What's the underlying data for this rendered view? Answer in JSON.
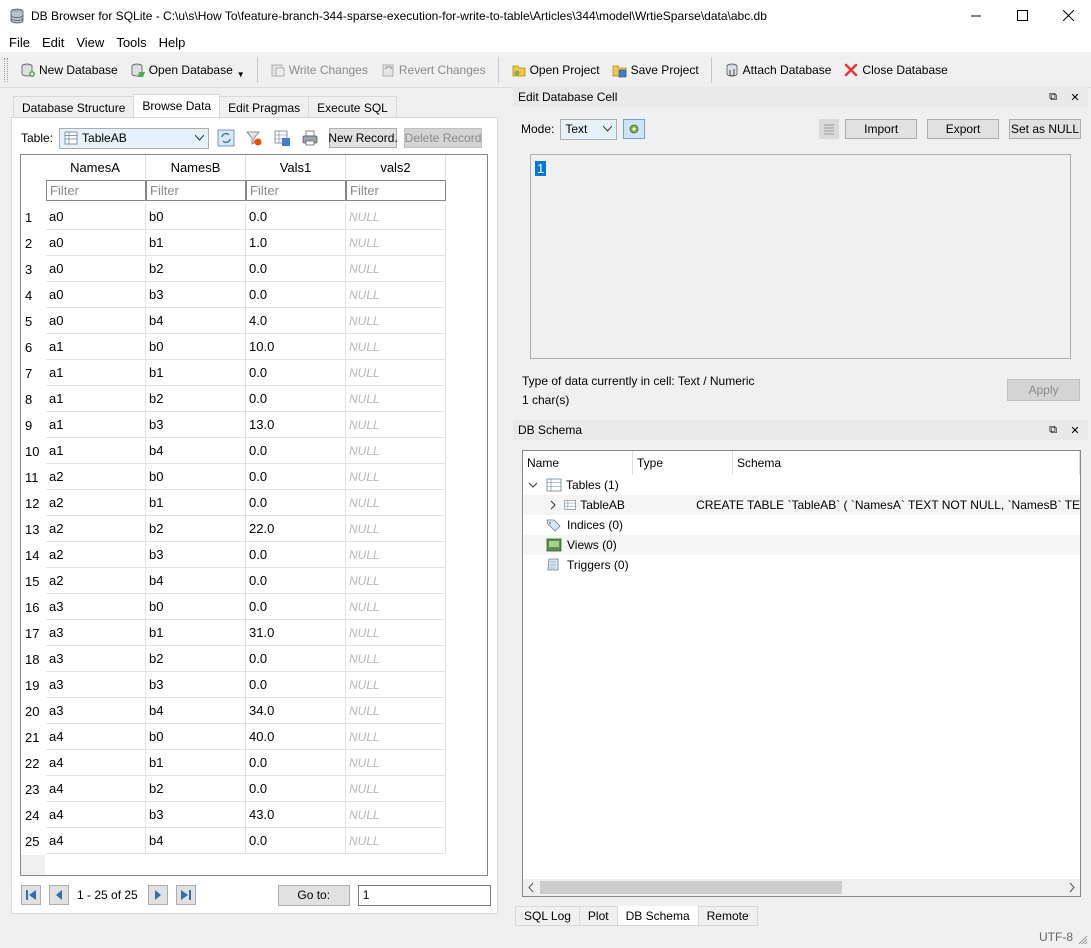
{
  "window": {
    "title": "DB Browser for SQLite - C:\\u\\s\\How To\\feature-branch-344-sparse-execution-for-write-to-table\\Articles\\344\\model\\WrtieSparse\\data\\abc.db",
    "minimize_icon": "minimize-icon",
    "maximize_icon": "maximize-icon",
    "close_icon": "close-icon"
  },
  "menu": [
    "File",
    "Edit",
    "View",
    "Tools",
    "Help"
  ],
  "toolbar": {
    "new_database": "New Database",
    "open_database": "Open Database",
    "write_changes": "Write Changes",
    "revert_changes": "Revert Changes",
    "open_project": "Open Project",
    "save_project": "Save Project",
    "attach_database": "Attach Database",
    "close_database": "Close Database"
  },
  "tabs": [
    "Database Structure",
    "Browse Data",
    "Edit Pragmas",
    "Execute SQL"
  ],
  "active_tab": "Browse Data",
  "browse": {
    "table_label": "Table:",
    "table_value": "TableAB",
    "new_record": "New Record.",
    "delete_record": "Delete Record",
    "columns": [
      "NamesA",
      "NamesB",
      "Vals1",
      "vals2"
    ],
    "filter_placeholder": "Filter",
    "rows": [
      [
        "1",
        "a0",
        "b0",
        "0.0",
        "NULL"
      ],
      [
        "2",
        "a0",
        "b1",
        "1.0",
        "NULL"
      ],
      [
        "3",
        "a0",
        "b2",
        "0.0",
        "NULL"
      ],
      [
        "4",
        "a0",
        "b3",
        "0.0",
        "NULL"
      ],
      [
        "5",
        "a0",
        "b4",
        "4.0",
        "NULL"
      ],
      [
        "6",
        "a1",
        "b0",
        "10.0",
        "NULL"
      ],
      [
        "7",
        "a1",
        "b1",
        "0.0",
        "NULL"
      ],
      [
        "8",
        "a1",
        "b2",
        "0.0",
        "NULL"
      ],
      [
        "9",
        "a1",
        "b3",
        "13.0",
        "NULL"
      ],
      [
        "10",
        "a1",
        "b4",
        "0.0",
        "NULL"
      ],
      [
        "11",
        "a2",
        "b0",
        "0.0",
        "NULL"
      ],
      [
        "12",
        "a2",
        "b1",
        "0.0",
        "NULL"
      ],
      [
        "13",
        "a2",
        "b2",
        "22.0",
        "NULL"
      ],
      [
        "14",
        "a2",
        "b3",
        "0.0",
        "NULL"
      ],
      [
        "15",
        "a2",
        "b4",
        "0.0",
        "NULL"
      ],
      [
        "16",
        "a3",
        "b0",
        "0.0",
        "NULL"
      ],
      [
        "17",
        "a3",
        "b1",
        "31.0",
        "NULL"
      ],
      [
        "18",
        "a3",
        "b2",
        "0.0",
        "NULL"
      ],
      [
        "19",
        "a3",
        "b3",
        "0.0",
        "NULL"
      ],
      [
        "20",
        "a3",
        "b4",
        "34.0",
        "NULL"
      ],
      [
        "21",
        "a4",
        "b0",
        "40.0",
        "NULL"
      ],
      [
        "22",
        "a4",
        "b1",
        "0.0",
        "NULL"
      ],
      [
        "23",
        "a4",
        "b2",
        "0.0",
        "NULL"
      ],
      [
        "24",
        "a4",
        "b3",
        "43.0",
        "NULL"
      ],
      [
        "25",
        "a4",
        "b4",
        "0.0",
        "NULL"
      ]
    ],
    "range_text": "1 - 25 of 25",
    "goto_label": "Go to:",
    "goto_value": "1"
  },
  "edit_cell": {
    "title": "Edit Database Cell",
    "mode_label": "Mode:",
    "mode_value": "Text",
    "import": "Import",
    "export": "Export",
    "set_null": "Set as NULL",
    "content": "1",
    "type_info": "Type of data currently in cell: Text / Numeric",
    "size_info": "1 char(s)",
    "apply": "Apply"
  },
  "schema": {
    "title": "DB Schema",
    "headers": [
      "Name",
      "Type",
      "Schema"
    ],
    "tables": "Tables (1)",
    "table_name": "TableAB",
    "table_schema": "CREATE TABLE `TableAB` ( `NamesA` TEXT NOT NULL, `NamesB` TE",
    "indices": "Indices (0)",
    "views": "Views (0)",
    "triggers": "Triggers (0)"
  },
  "bottom_tabs": [
    "SQL Log",
    "Plot",
    "DB Schema",
    "Remote"
  ],
  "status": {
    "encoding": "UTF-8"
  }
}
